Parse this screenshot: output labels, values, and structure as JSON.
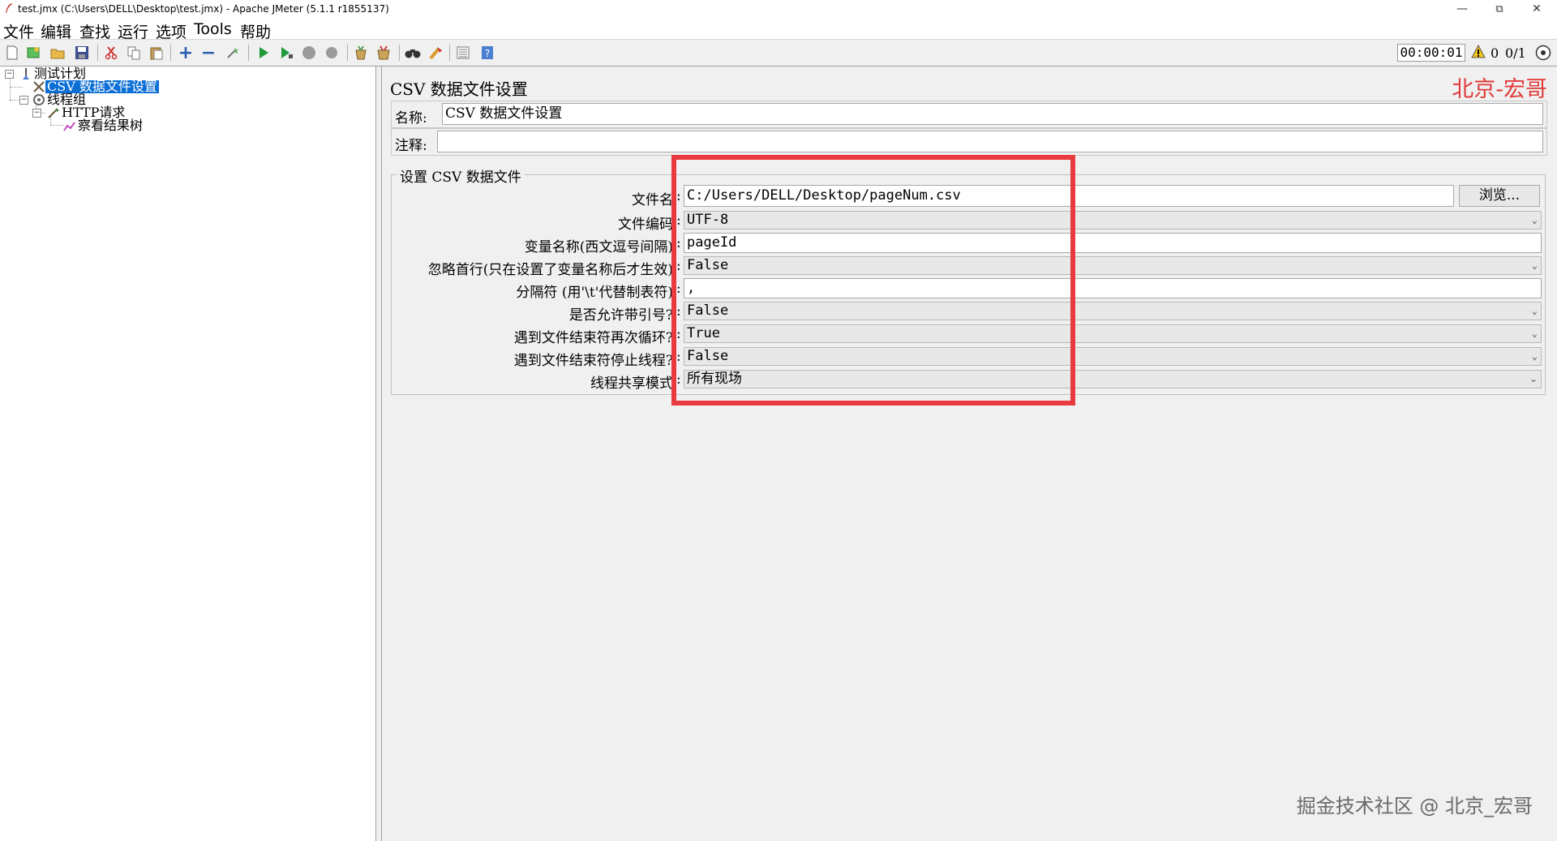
{
  "window": {
    "title": "test.jmx (C:\\Users\\DELL\\Desktop\\test.jmx) - Apache JMeter (5.1.1 r1855137)",
    "controls": [
      "minimize",
      "restore",
      "close"
    ]
  },
  "menu": [
    "文件",
    "编辑",
    "查找",
    "运行",
    "选项",
    "Tools",
    "帮助"
  ],
  "toolbar": {
    "icons": [
      "new-icon",
      "templates-icon",
      "open-icon",
      "save-icon",
      "cut-icon",
      "copy-icon",
      "paste-icon",
      "expand-icon",
      "collapse-icon",
      "toggle-icon",
      "start-icon",
      "start-no-pause-icon",
      "stop-icon",
      "shutdown-icon",
      "clear-icon",
      "clear-all-icon",
      "search-icon",
      "reset-search-icon",
      "function-helper-icon",
      "help-icon"
    ],
    "timer": "00:00:01",
    "warning_count": "0",
    "threads": "0/1"
  },
  "tree": {
    "items": [
      {
        "label": "测试计划",
        "icon": "test-plan-icon"
      },
      {
        "label": "CSV 数据文件设置",
        "icon": "csv-config-icon",
        "selected": true
      },
      {
        "label": "线程组",
        "icon": "thread-group-icon"
      },
      {
        "label": "HTTP请求",
        "icon": "http-sampler-icon"
      },
      {
        "label": "察看结果树",
        "icon": "result-tree-icon"
      }
    ]
  },
  "panel": {
    "title": "CSV 数据文件设置",
    "brand": "北京-宏哥",
    "name_label": "名称:",
    "name_value": "CSV 数据文件设置",
    "comment_label": "注释:",
    "comment_value": "",
    "section_title": "设置 CSV 数据文件",
    "fields": [
      {
        "label": "文件名",
        "value": "C:/Users/DELL/Desktop/pageNum.csv",
        "type": "text"
      },
      {
        "label": "文件编码",
        "value": "UTF-8",
        "type": "combo"
      },
      {
        "label": "变量名称(西文逗号间隔)",
        "value": "pageId",
        "type": "text"
      },
      {
        "label": "忽略首行(只在设置了变量名称后才生效)",
        "value": "False",
        "type": "combo"
      },
      {
        "label": "分隔符 (用'\\t'代替制表符)",
        "value": ",",
        "type": "text"
      },
      {
        "label": "是否允许带引号?",
        "value": "False",
        "type": "combo"
      },
      {
        "label": "遇到文件结束符再次循环?",
        "value": "True",
        "type": "combo"
      },
      {
        "label": "遇到文件结束符停止线程?",
        "value": "False",
        "type": "combo"
      },
      {
        "label": "线程共享模式",
        "value": "所有现场",
        "type": "combo"
      }
    ],
    "browse_label": "浏览..."
  },
  "watermark": "掘金技术社区 @ 北京_宏哥",
  "colors": {
    "selection": "#0b6fd6",
    "highlight_box": "#e83a3f",
    "brand": "#e03a3a"
  }
}
